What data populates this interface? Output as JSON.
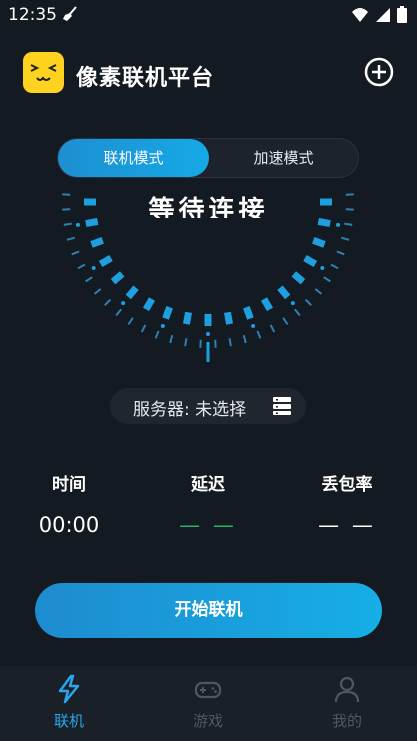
{
  "status_bar": {
    "time": "12:35"
  },
  "header": {
    "title": "像素联机平台"
  },
  "mode_switch": {
    "active": "联机模式",
    "inactive": "加速模式"
  },
  "dial": {
    "label": "等待连接"
  },
  "server": {
    "label": "服务器: 未选择"
  },
  "stats": [
    {
      "title": "时间",
      "value": "00:00"
    },
    {
      "title": "延迟",
      "value": "— —"
    },
    {
      "title": "丢包率",
      "value": "— —"
    }
  ],
  "connect_button": {
    "label": "开始联机"
  },
  "nav": [
    {
      "label": "联机",
      "icon": "lightning-icon",
      "active": true
    },
    {
      "label": "游戏",
      "icon": "gamepad-icon",
      "active": false
    },
    {
      "label": "我的",
      "icon": "person-icon",
      "active": false
    }
  ],
  "colors": {
    "accent": "#1d9fe0",
    "background": "#141a21",
    "logo": "#ffd21f",
    "latency": "#2fb26a"
  }
}
